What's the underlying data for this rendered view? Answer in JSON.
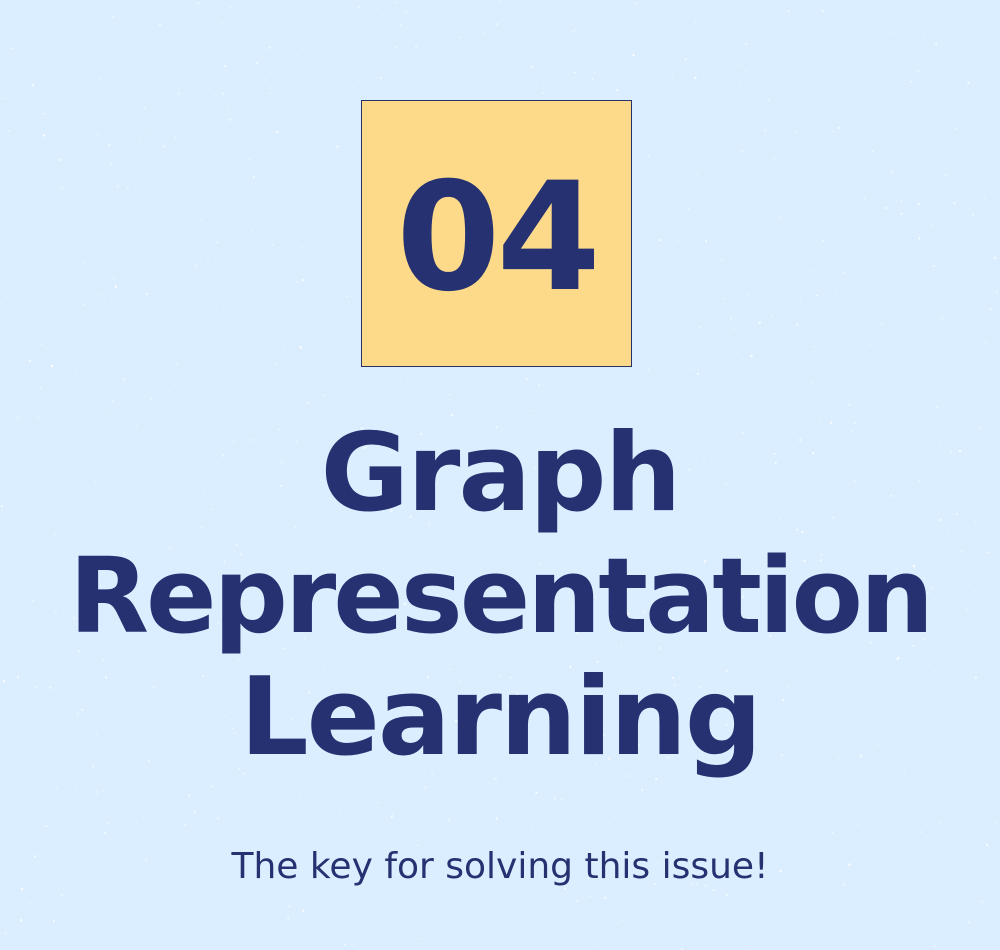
{
  "section": {
    "number": "04"
  },
  "title": {
    "line_1": "Graph",
    "line_2": "Representation",
    "line_3": "Learning"
  },
  "subtitle": "The key for solving this issue!",
  "colors": {
    "background": "#dbeeff",
    "number_box_fill": "#fcda8a",
    "text": "#253170"
  }
}
